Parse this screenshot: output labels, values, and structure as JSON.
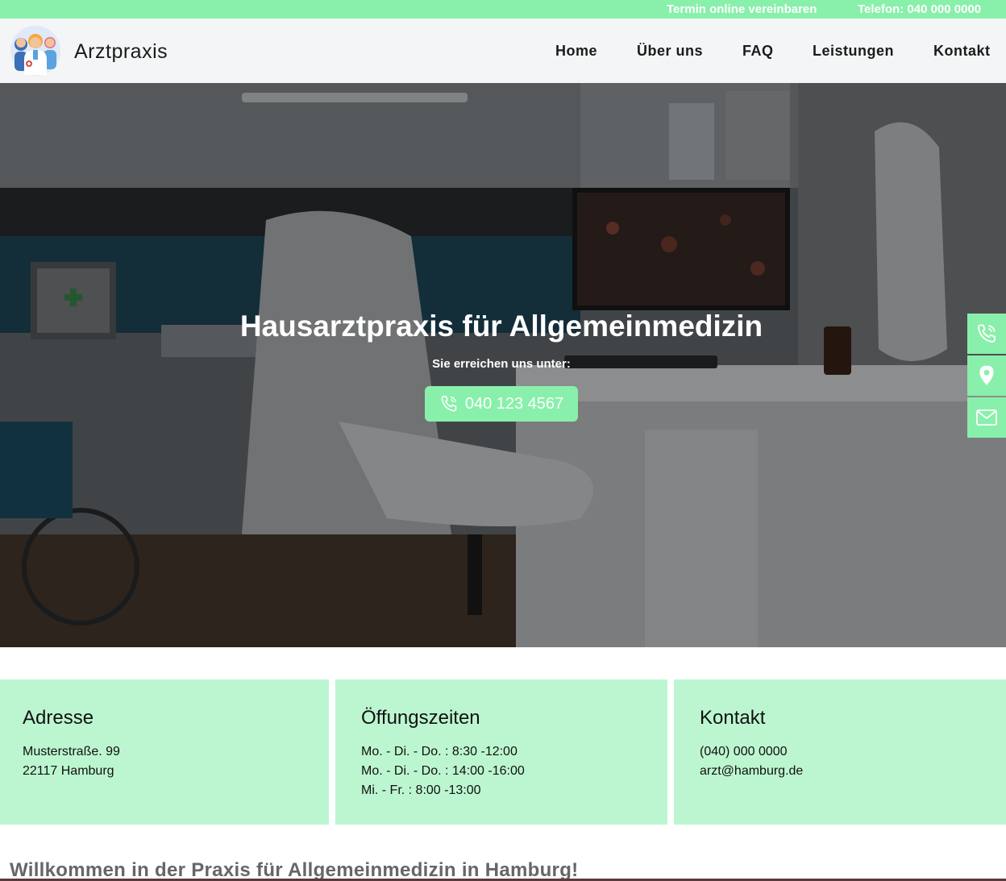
{
  "topbar": {
    "appointment_link": "Termin online vereinbaren",
    "phone_link": "Telefon: 040 000 0000"
  },
  "header": {
    "brand": "Arztpraxis",
    "nav": [
      {
        "label": "Home"
      },
      {
        "label": "Über uns"
      },
      {
        "label": "FAQ"
      },
      {
        "label": "Leistungen"
      },
      {
        "label": "Kontakt"
      }
    ]
  },
  "hero": {
    "title": "Hausarztpraxis für Allgemeinmedizin",
    "subtitle": "Sie erreichen uns unter:",
    "phone_button": "040 123 4567"
  },
  "side_buttons": [
    {
      "icon": "phone-icon"
    },
    {
      "icon": "location-pin-icon"
    },
    {
      "icon": "mail-icon"
    }
  ],
  "info_boxes": {
    "address": {
      "title": "Adresse",
      "lines": [
        "Musterstraße. 99",
        "22117 Hamburg"
      ]
    },
    "hours": {
      "title": "Öffungszeiten",
      "lines": [
        "Mo. - Di. - Do. : 8:30 -12:00",
        "Mo. - Di. - Do. : 14:00 -16:00",
        "Mi. - Fr. : 8:00 -13:00"
      ]
    },
    "contact": {
      "title": "Kontakt",
      "lines": [
        "(040) 000 0000",
        "arzt@hamburg.de"
      ]
    }
  },
  "welcome": "Willkommen in der Praxis für Allgemeinmedizin in Hamburg!",
  "colors": {
    "accent": "#88f0aa",
    "info_bg": "#bcf6d0",
    "header_bg": "#f4f5f6"
  }
}
